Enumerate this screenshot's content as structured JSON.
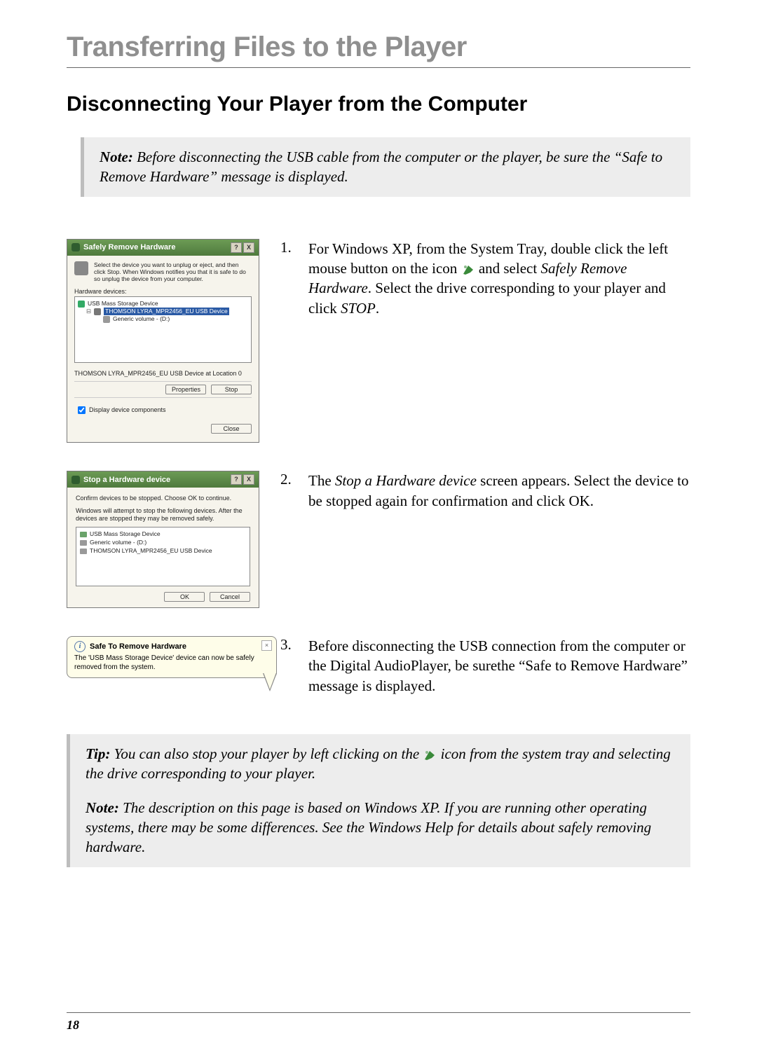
{
  "page": {
    "title": "Transferring Files to the Player",
    "section": "Disconnecting Your Player from the Computer",
    "number": "18"
  },
  "note1": {
    "label": "Note:",
    "text": " Before disconnecting the USB cable from the computer or the player, be sure the “Safe to Remove Hardware” message is displayed."
  },
  "dialog1": {
    "title": "Safely Remove Hardware",
    "instruction": "Select the device you want to unplug or eject, and then click Stop. When Windows notifies you that it is safe to do so unplug the device from your computer.",
    "hw_label": "Hardware devices:",
    "list": {
      "root": "USB Mass Storage Device",
      "sel": "THOMSON LYRA_MPR2456_EU USB Device",
      "child": "Generic volume - (D:)"
    },
    "status": "THOMSON LYRA_MPR2456_EU USB Device at Location 0",
    "properties": "Properties",
    "stop": "Stop",
    "checkbox": "Display device components",
    "close": "Close",
    "help": "?",
    "x": "X"
  },
  "dialog2": {
    "title": "Stop a Hardware device",
    "line1": "Confirm devices to be stopped. Choose OK to continue.",
    "line2": "Windows will attempt to stop the following devices. After the devices are stopped they may be removed safely.",
    "list": {
      "a": "USB Mass Storage Device",
      "b": "Generic volume - (D:)",
      "c": "THOMSON LYRA_MPR2456_EU USB Device"
    },
    "ok": "OK",
    "cancel": "Cancel"
  },
  "balloon": {
    "title": "Safe To Remove Hardware",
    "body": "The 'USB Mass Storage Device' device can now be safely removed from the system.",
    "x": "×",
    "i": "i"
  },
  "steps": {
    "s1a": "For Windows XP, from the System Tray, double click the left mouse button on the icon ",
    "s1b": " and select ",
    "s1c": "Safely Remove Hardware",
    "s1d": ". Select the drive corresponding to your player and click ",
    "s1e": "STOP",
    "s1f": ".",
    "s2a": "The ",
    "s2b": "Stop a Hardware device",
    "s2c": " screen appears. Select the device to be stopped again for confirmation and click OK.",
    "s3": "Before disconnecting the USB connection from the computer or the Digital AudioPlayer, be surethe “Safe to Remove Hardware” message is displayed.",
    "n1": "1.",
    "n2": "2.",
    "n3": "3."
  },
  "tip": {
    "label": "Tip:",
    "a": " You can also stop your player by left clicking on the ",
    "b": " icon from the system tray and selecting the drive corresponding to your player."
  },
  "note2": {
    "label": "Note:",
    "text": " The description on this page is based on Windows XP. If you are running other operating systems, there may be some differences. See the Windows Help for details about safely removing hardware."
  }
}
